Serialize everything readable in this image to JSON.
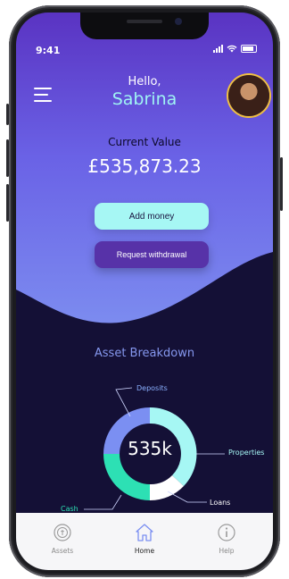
{
  "status_bar": {
    "time": "9:41"
  },
  "header": {
    "greeting": "Hello,",
    "user_name": "Sabrina"
  },
  "portfolio": {
    "label": "Current Value",
    "value": "£535,873.23"
  },
  "actions": {
    "add_money": "Add money",
    "request_withdrawal": "Request withdrawal"
  },
  "breakdown": {
    "title": "Asset Breakdown",
    "center_label": "535k",
    "segments": [
      {
        "name": "Deposits",
        "color": "#7b8ff2"
      },
      {
        "name": "Properties",
        "color": "#a6f7f4"
      },
      {
        "name": "Loans",
        "color": "#ffffff"
      },
      {
        "name": "Cash",
        "color": "#2de0b4"
      }
    ]
  },
  "tabs": [
    {
      "label": "Assets",
      "icon": "assets-icon"
    },
    {
      "label": "Home",
      "icon": "home-icon"
    },
    {
      "label": "Help",
      "icon": "help-icon"
    }
  ],
  "colors": {
    "accent_cyan": "#a6f7f4",
    "accent_purple": "#5732a8",
    "background_dark": "#141036",
    "tab_active": "#7b8ff2"
  }
}
